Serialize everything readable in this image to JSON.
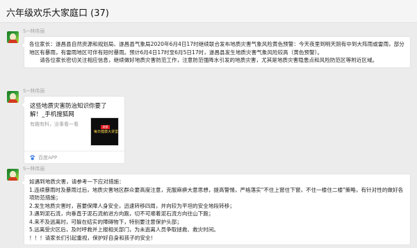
{
  "window": {
    "title": "六年级欢乐大家庭口 (37)"
  },
  "messages": [
    {
      "sender": "S~林伟丽",
      "paragraphs": [
        "各位家长：遂昌县自然资源和规划局、遂昌县气象局2020年6月4日17时继续联合发布地质灾害气象风险黄色预警：今天夜里到明天阴有中到大阵雨或雷雨，部分地区有暴雨，有雷雨地区可伴有短时暴雨。预计6月4日17时至6月5日17时，遂昌县发生地质灾害气象风险较高（黄色预警）。",
        "请各位家长密切关注相应信息，继续做好地质灾害防范工作，注意防范强降水引发的地质灾害，尤其是地质灾害隐患点和风险防范区等附近区域。"
      ]
    },
    {
      "sender": "S~林伟丽",
      "card": {
        "title": "这些地质灾害防治知识你要了解！_手机搜狐网",
        "description": "有趣有料，没事看一看",
        "thumb_tag": "遂昌",
        "thumb_caption": "每日健康大讲堂",
        "source": "百度APP",
        "source_icon": "paw-icon"
      }
    },
    {
      "sender": "S~林伟丽",
      "paragraphs": [
        "如遇到地质灾害，请参考一下应对措施：",
        "1.连续暴雨时及暴雨过后，地质灾害地区群众要高度注意，克服麻痹大意思想，提高警惕，严格落实\"不住上窗住下窗，不住一楼住二楼\"策略，有针对性的做好各项防范措施；",
        "2.发生地质灾害时，首要保障人身安全，迅速转移四周，并向较为平坦的安全地段转移；",
        "3.遇到泥石流，向垂直于泥石流前进方向跑，切不可顺着泥石流方向往山下跑；",
        "4.来不及逃离时，可躲在结实的障碍物下，特别要注意保护头部；",
        "5.远离受灾区后，及时呼救并上报相关部门，为未逃离人员争取拯救、救灾时间。",
        "！！！请家长们引起重视，保护好自身和孩子的安全！"
      ]
    }
  ],
  "colors": {
    "chat_bg": "#ececec",
    "bubble_bg": "#ffffff",
    "sender": "#a3a3a3"
  }
}
